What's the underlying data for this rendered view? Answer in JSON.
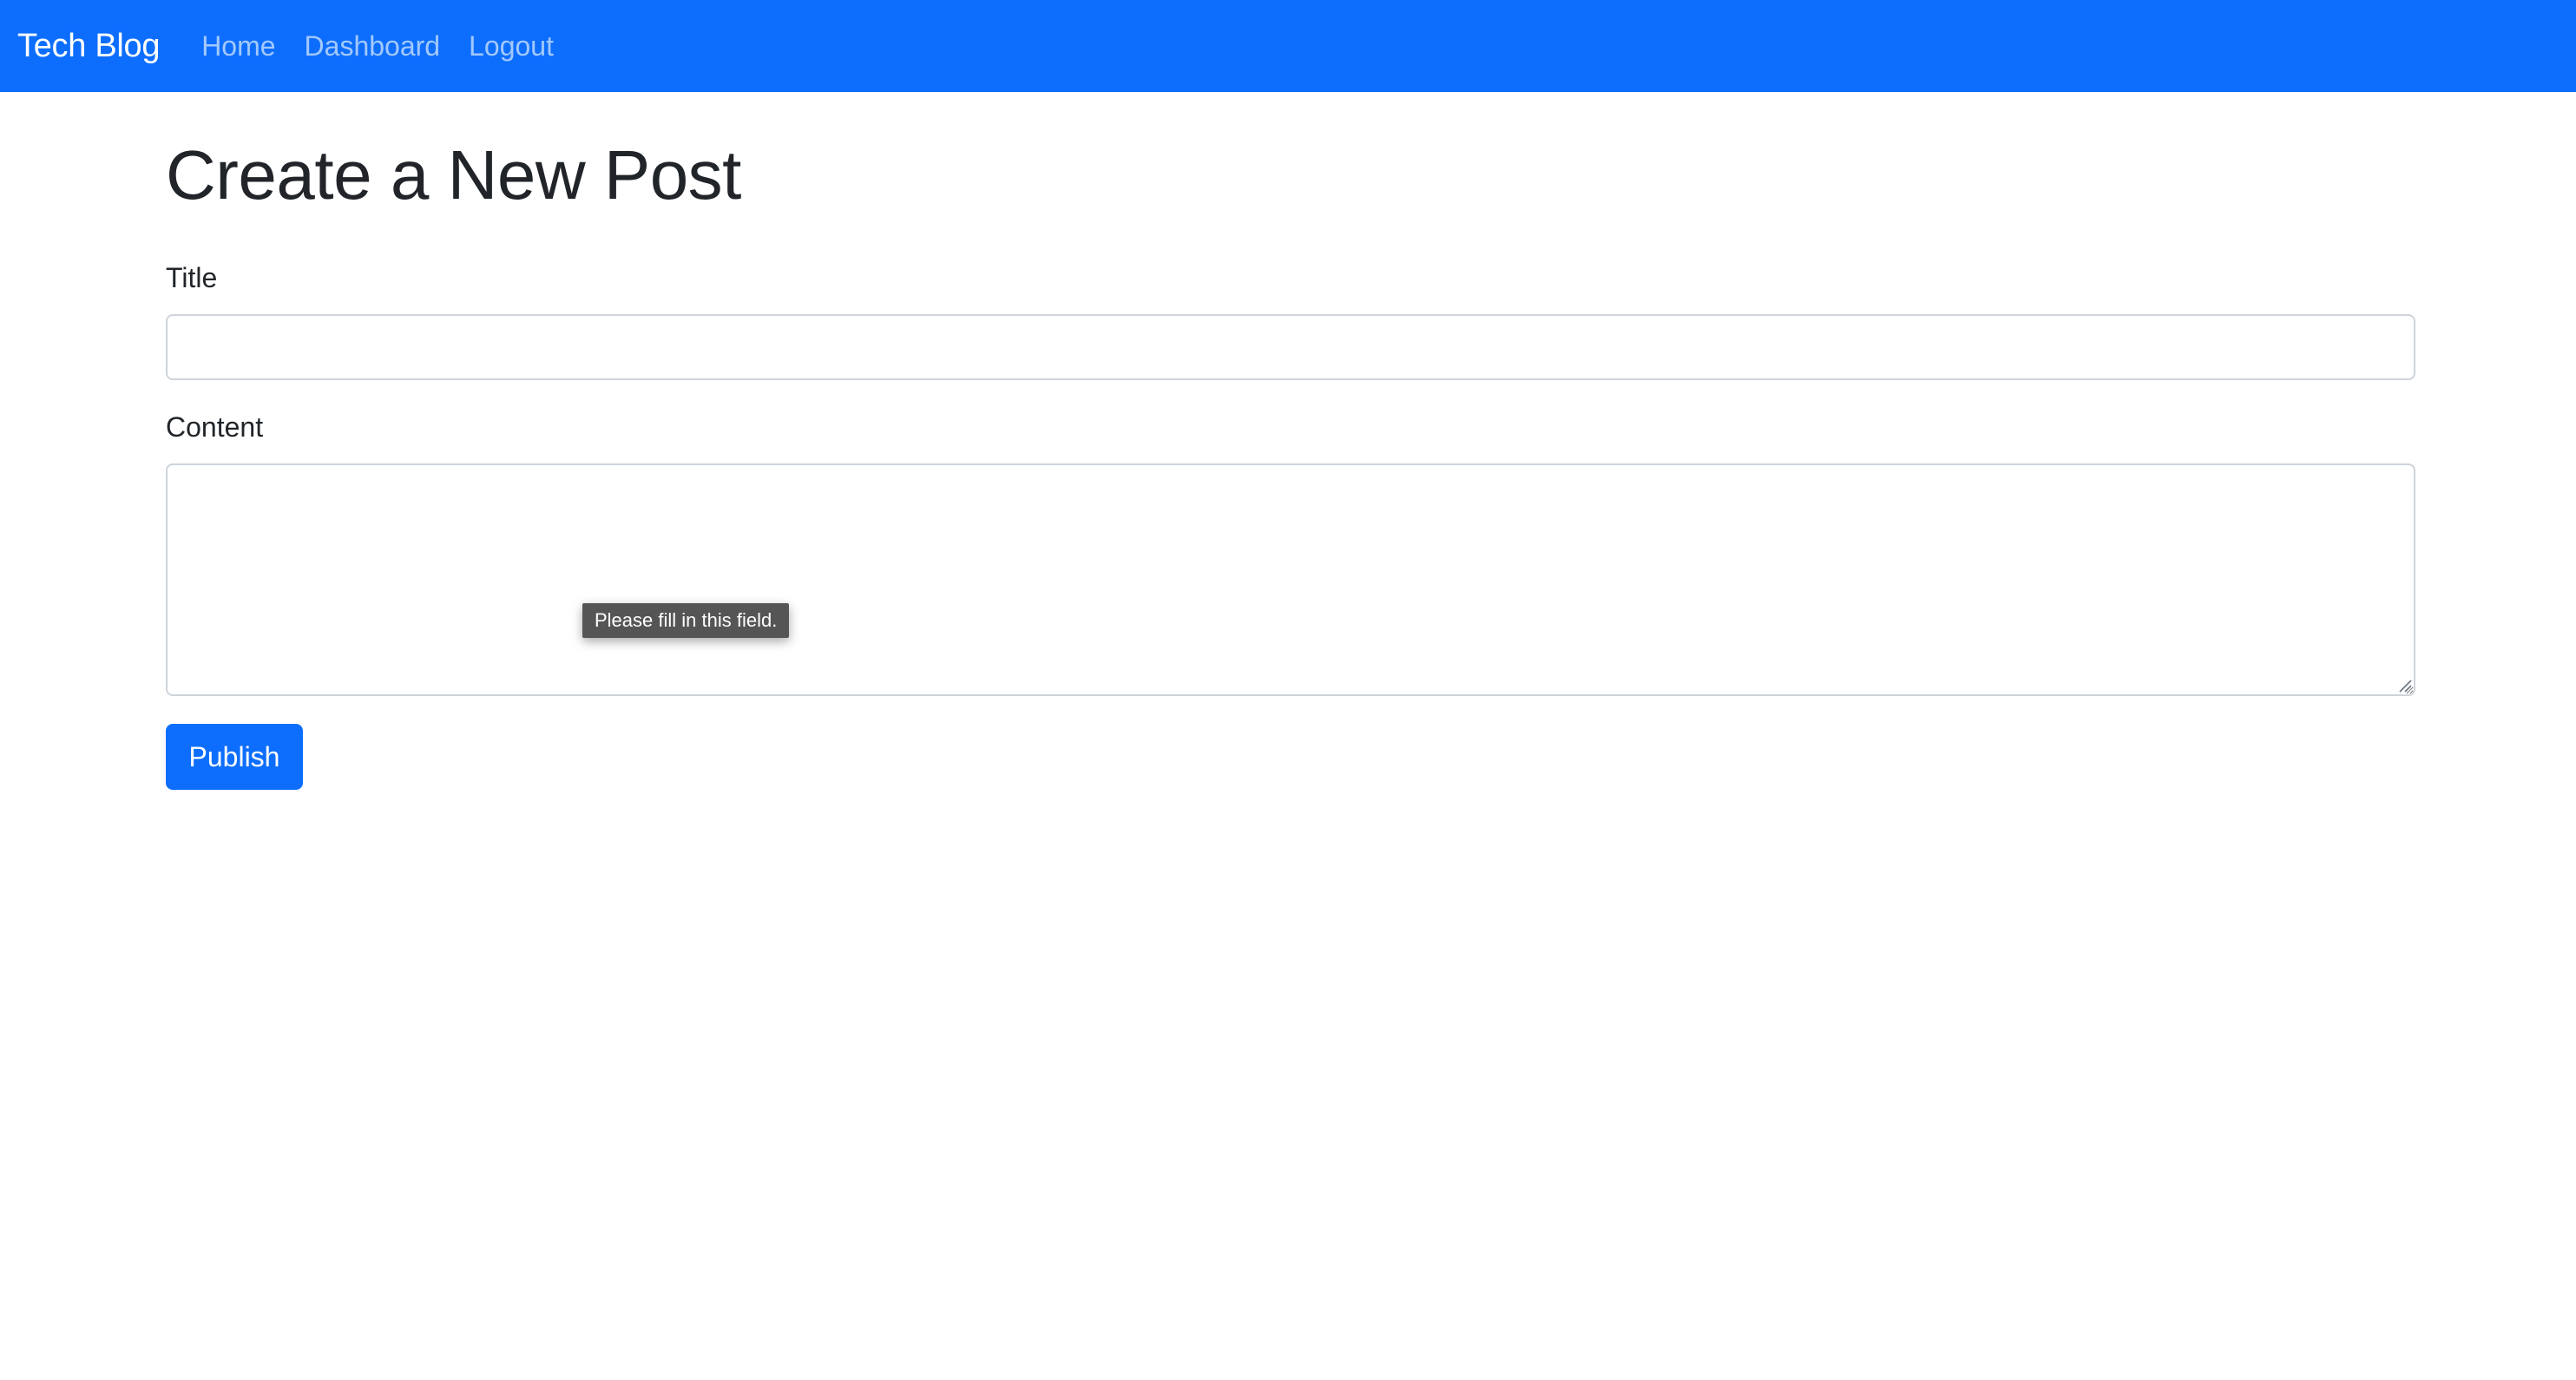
{
  "navbar": {
    "brand": "Tech Blog",
    "links": [
      "Home",
      "Dashboard",
      "Logout"
    ],
    "background": "#0d6efd"
  },
  "page": {
    "title": "Create a New Post"
  },
  "form": {
    "title_label": "Title",
    "title_value": "",
    "content_label": "Content",
    "content_value": "",
    "validation_tooltip": "Please fill in this field.",
    "submit_label": "Publish"
  },
  "colors": {
    "primary": "#0d6efd",
    "text": "#212529",
    "input_border": "#ced4da",
    "tooltip_bg": "#555555"
  }
}
